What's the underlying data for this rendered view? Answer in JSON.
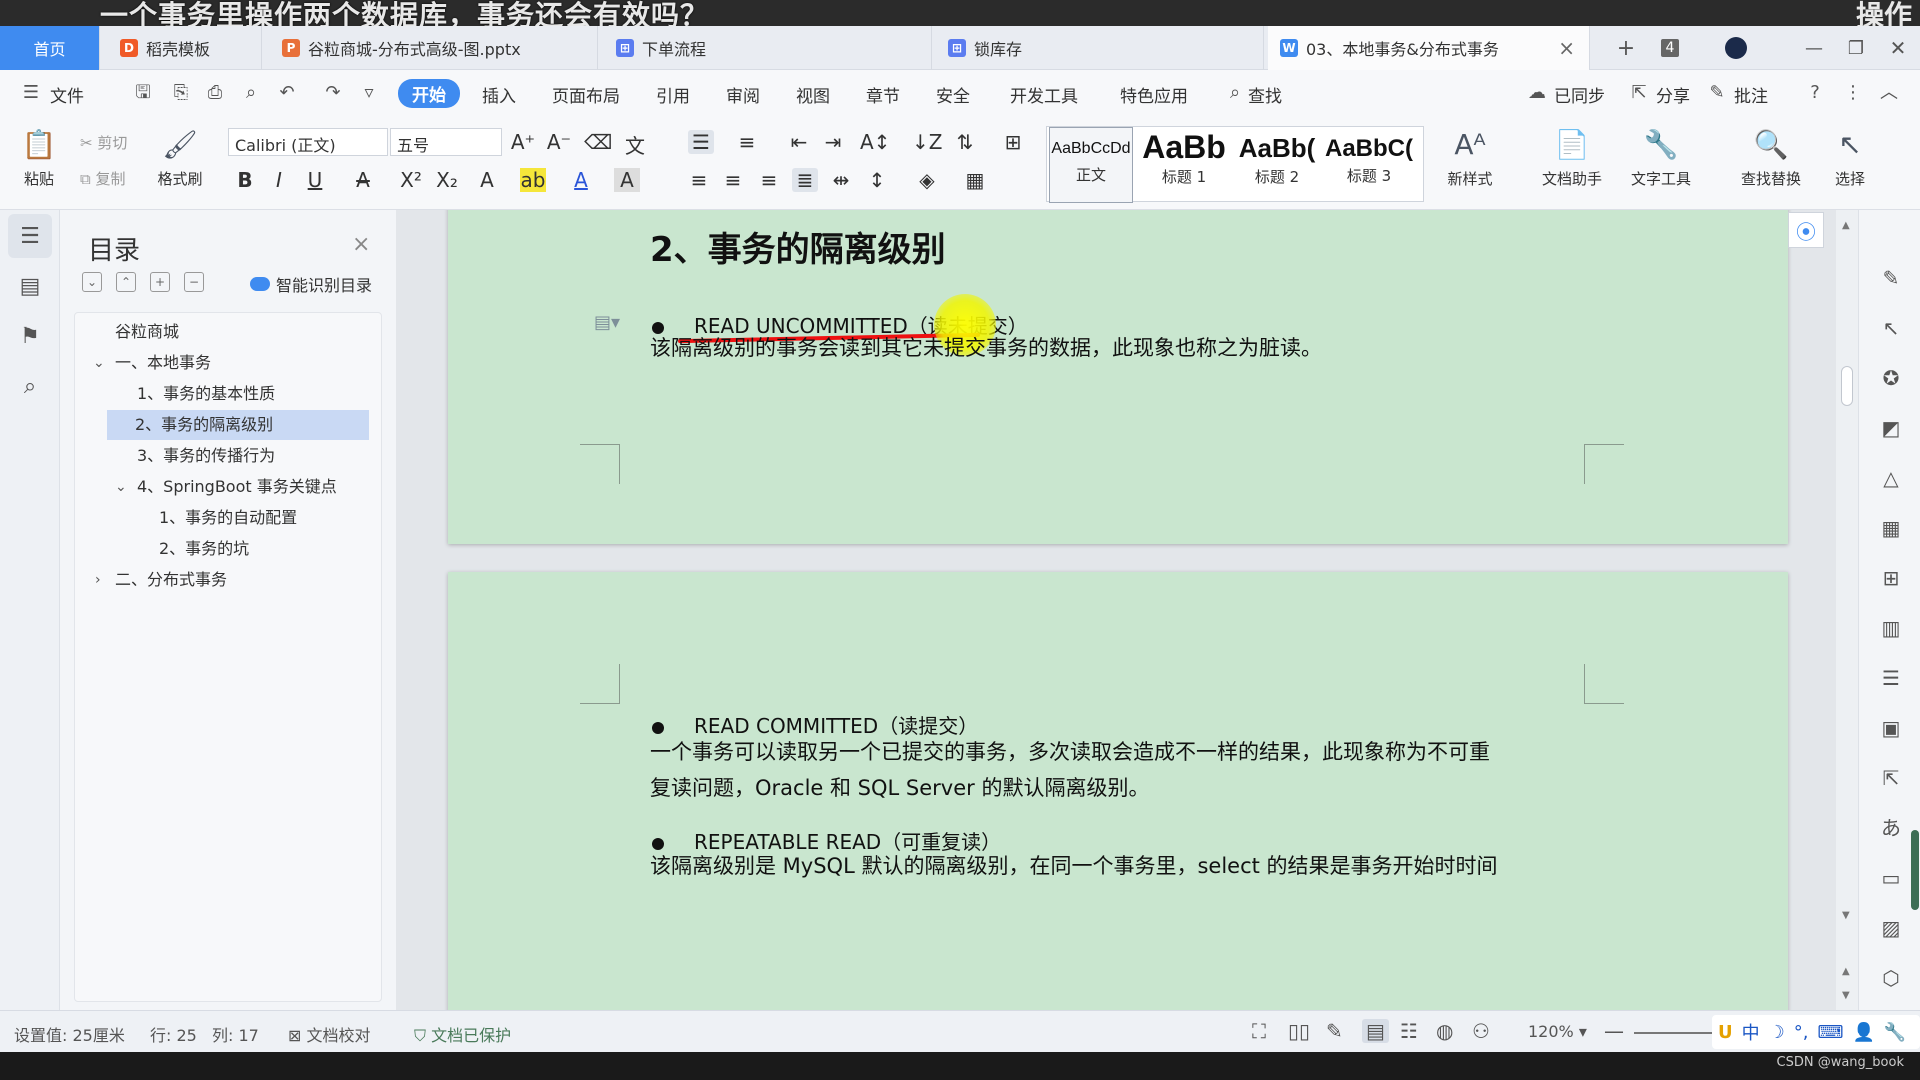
{
  "caption": {
    "text": "一个事务里操作两个数据库，事务还会有效吗？",
    "right": "操作"
  },
  "tabs": [
    {
      "label": "首页",
      "icon": "home"
    },
    {
      "label": "稻壳模板",
      "icon": "docer-icon",
      "color": "#f05a28"
    },
    {
      "label": "谷粒商城-分布式高级-图.pptx",
      "icon": "ppt-icon",
      "color": "#e8703a"
    },
    {
      "label": "下单流程",
      "icon": "flowchart-icon",
      "color": "#5b7cf0"
    },
    {
      "label": "锁库存",
      "icon": "flowchart-icon",
      "color": "#5b7cf0"
    },
    {
      "label": "03、本地事务&分布式事务",
      "icon": "word-icon",
      "color": "#3f8bf0"
    }
  ],
  "tab_count": "4",
  "menu": {
    "file": "文件",
    "items": [
      "开始",
      "插入",
      "页面布局",
      "引用",
      "审阅",
      "视图",
      "章节",
      "安全",
      "开发工具",
      "特色应用"
    ],
    "search": "查找",
    "synced": "已同步",
    "share": "分享",
    "comment": "批注"
  },
  "ribbon": {
    "paste": "粘贴",
    "cut": "剪切",
    "copy": "复制",
    "format_painter": "格式刷",
    "font": "Calibri (正文)",
    "size": "五号",
    "styles": [
      {
        "sample": "AaBbCcDd",
        "label": "正文"
      },
      {
        "sample": "AaBb",
        "label": "标题 1"
      },
      {
        "sample": "AaBb(",
        "label": "标题 2"
      },
      {
        "sample": "AaBbC(",
        "label": "标题 3"
      }
    ],
    "new_style": "新样式",
    "doc_helper": "文档助手",
    "text_tools": "文字工具",
    "find_replace": "查找替换",
    "select": "选择"
  },
  "toc": {
    "title": "目录",
    "smart": "智能识别目录",
    "items": [
      {
        "label": "谷粒商城",
        "level": 0,
        "arrow": ""
      },
      {
        "label": "一、本地事务",
        "level": 0,
        "arrow": "expanded"
      },
      {
        "label": "1、事务的基本性质",
        "level": 1,
        "arrow": ""
      },
      {
        "label": "2、事务的隔离级别",
        "level": 1,
        "arrow": "",
        "selected": true
      },
      {
        "label": "3、事务的传播行为",
        "level": 1,
        "arrow": ""
      },
      {
        "label": "4、SpringBoot 事务关键点",
        "level": 1,
        "arrow": "expanded"
      },
      {
        "label": "1、事务的自动配置",
        "level": 2,
        "arrow": ""
      },
      {
        "label": "2、事务的坑",
        "level": 2,
        "arrow": ""
      },
      {
        "label": "二、分布式事务",
        "level": 0,
        "arrow": "collapsed"
      }
    ]
  },
  "document": {
    "heading": "2、事务的隔离级别",
    "b1_title": "READ UNCOMMITTED（读未提交）",
    "b1_text": "该隔离级别的事务会读到其它未提交事务的数据，此现象也称之为脏读。",
    "b2_title": "READ COMMITTED（读提交）",
    "b2_text_1": "一个事务可以读取另一个已提交的事务，多次读取会造成不一样的结果，此现象称为不可重",
    "b2_text_2": "复读问题，Oracle 和 SQL Server 的默认隔离级别。",
    "b3_title": "REPEATABLE READ（可重复读）",
    "b3_text": "该隔离级别是 MySQL 默认的隔离级别，在同一个事务里，select 的结果是事务开始时时间",
    "page_color": "#c9e6cf"
  },
  "status": {
    "setting": "设置值: 25厘米",
    "row": "行: 25",
    "col": "列: 17",
    "proof": "文档校对",
    "protected": "文档已保护",
    "zoom": "120%"
  },
  "ime": {
    "lang": "中"
  },
  "watermark": "CSDN @wang_book"
}
